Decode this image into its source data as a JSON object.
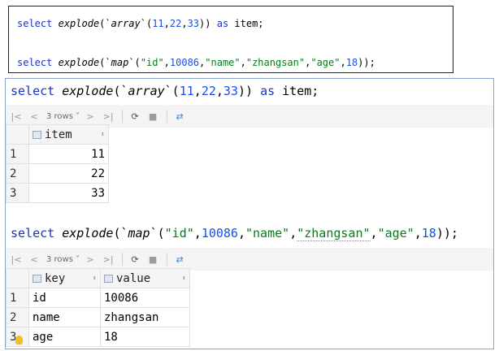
{
  "snippet": {
    "line1": {
      "kw_select": "select",
      "fn": "explode",
      "open": "(`",
      "type": "array",
      "close_tick": "`(",
      "n1": "11",
      "c1": ",",
      "n2": "22",
      "c2": ",",
      "n3": "33",
      "end": "))",
      "kw_as": "as",
      "alias": "item;"
    },
    "line2": {
      "kw_select": "select",
      "fn": "explode",
      "open": "(`",
      "type": "map",
      "close_tick": "`(",
      "s1": "\"id\"",
      "c1": ",",
      "n1": "10086",
      "c2": ",",
      "s2": "\"name\"",
      "c3": ",",
      "s3": "\"zhangsan\"",
      "c4": ",",
      "s4": "\"age\"",
      "c5": ",",
      "n2": "18",
      "end": "));"
    }
  },
  "query1": {
    "kw_select": "select",
    "fn": "explode",
    "open": "(`",
    "type": "array",
    "close_tick": "`(",
    "n1": "11",
    "c1": ",",
    "n2": "22",
    "c2": ",",
    "n3": "33",
    "end": "))",
    "kw_as": "as",
    "alias": "item;"
  },
  "query2": {
    "kw_select": "select",
    "fn": "explode",
    "open": "(`",
    "type": "map",
    "close_tick": "`(",
    "s1": "\"id\"",
    "c1": ",",
    "n1": "10086",
    "c2": ",",
    "s2": "\"name\"",
    "c3": ",",
    "s3": "\"zhangsan\"",
    "c4": ",",
    "s4": "\"age\"",
    "c5": ",",
    "n2": "18",
    "end": "));"
  },
  "toolbar1": {
    "first": "|<",
    "prev": "<",
    "rows": "3 rows ˅",
    "next": ">",
    "last": ">|",
    "refresh": "⟳",
    "stop": "■",
    "pin": "⇄"
  },
  "toolbar2": {
    "first": "|<",
    "prev": "<",
    "rows": "3 rows ˅",
    "next": ">",
    "last": ">|",
    "refresh": "⟳",
    "stop": "■",
    "pin": "⇄"
  },
  "result1": {
    "columns": [
      "item"
    ],
    "rows": [
      {
        "n": "1",
        "item": "11"
      },
      {
        "n": "2",
        "item": "22"
      },
      {
        "n": "3",
        "item": "33"
      }
    ]
  },
  "result2": {
    "columns": [
      "key",
      "value"
    ],
    "rows": [
      {
        "n": "1",
        "key": "id",
        "value": "10086"
      },
      {
        "n": "2",
        "key": "name",
        "value": "zhangsan"
      },
      {
        "n": "3",
        "key": "age",
        "value": "18"
      }
    ]
  },
  "sort_glyph": "⬍"
}
